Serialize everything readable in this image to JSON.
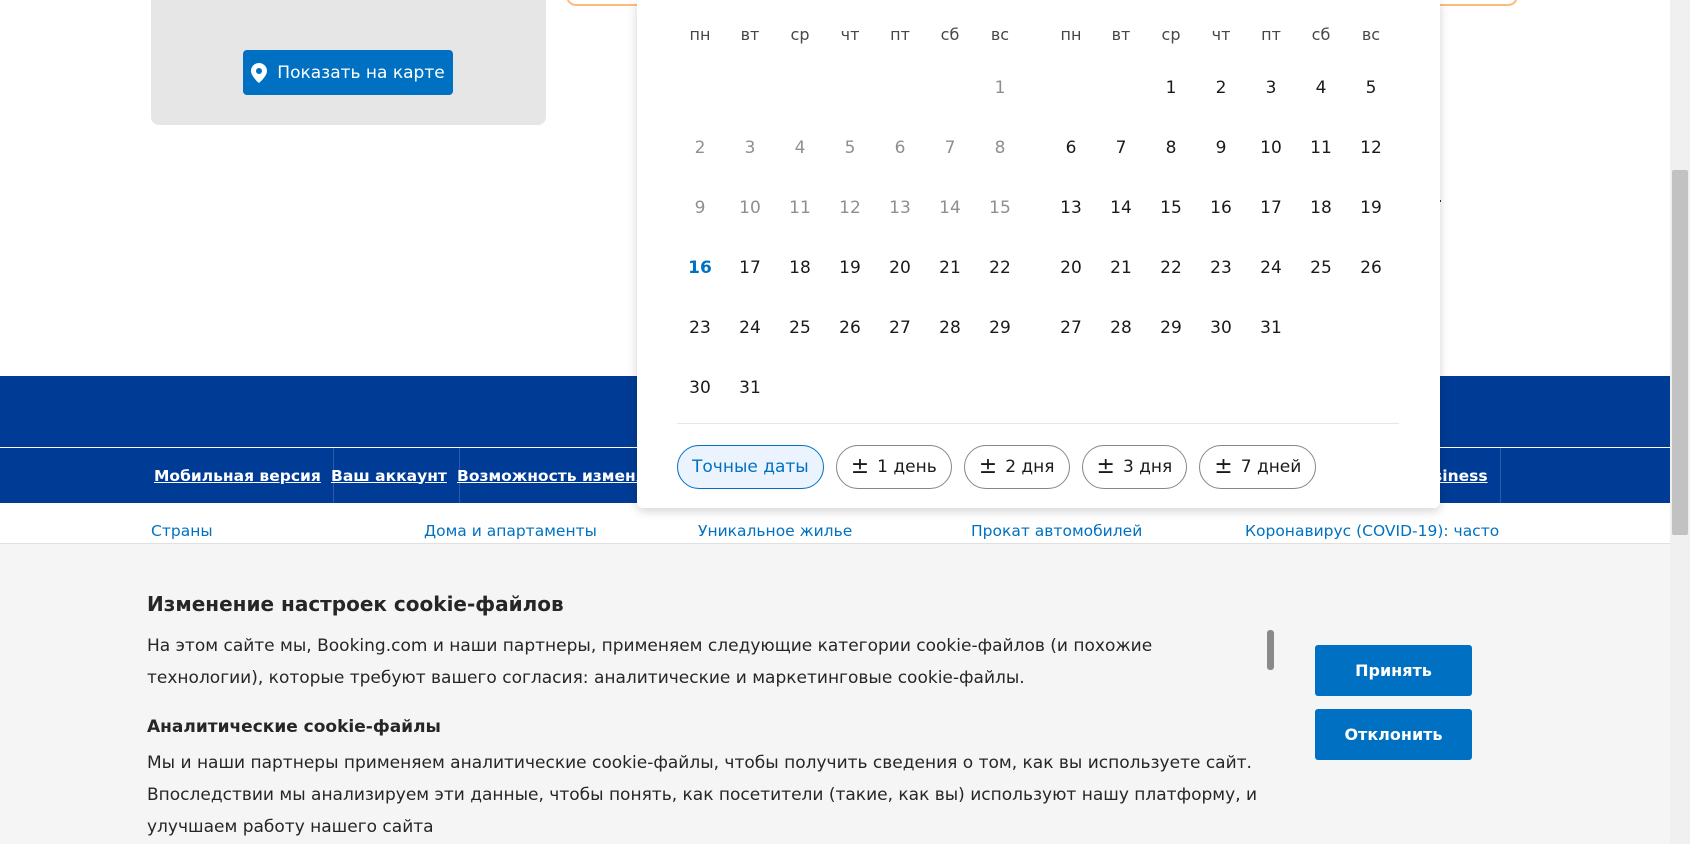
{
  "map": {
    "show_on_map_label": "Показать на карте"
  },
  "calendar": {
    "weekdays": [
      "пн",
      "вт",
      "ср",
      "чт",
      "пт",
      "сб",
      "вс"
    ],
    "month_a": {
      "offset": 6,
      "days": 31,
      "past_until": 15,
      "today": 16
    },
    "month_b": {
      "offset": 2,
      "days": 31,
      "past_until": 0,
      "today": 0
    },
    "flex_options": [
      {
        "label": "Точные даты",
        "active": true,
        "prefix": ""
      },
      {
        "label": "1 день",
        "active": false,
        "prefix": "±"
      },
      {
        "label": "2 дня",
        "active": false,
        "prefix": "±"
      },
      {
        "label": "3 дня",
        "active": false,
        "prefix": "±"
      },
      {
        "label": "7 дней",
        "active": false,
        "prefix": "±"
      }
    ]
  },
  "footer_nav": [
    "Мобильная версия",
    "Ваш аккаунт",
    "Возможность изменят",
    "usiness"
  ],
  "footer_links": [
    "Страны",
    "Дома и апартаменты",
    "Уникальное жилье",
    "Прокат автомобилей",
    "Коронавирус (COVID-19): часто"
  ],
  "cookie": {
    "title": "Изменение настроек cookie-файлов",
    "intro": "На этом сайте мы, Booking.com и наши партнеры, применяем следующие категории cookie-файлов (и похожие технологии), которые требуют вашего согласия: аналитические и маркетинговые cookie-файлы.",
    "analytics_title": "Аналитические cookie-файлы",
    "analytics_text": "Мы и наши партнеры применяем аналитические cookie-файлы, чтобы получить сведения о том, как вы используете сайт. Впоследствии мы анализируем эти данные, чтобы понять, как посетители (такие, как вы) используют нашу платформу, и улучшаем работу нашего сайта",
    "accept_label": "Принять",
    "reject_label": "Отклонить"
  },
  "colors": {
    "brand_blue": "#0071c2",
    "dark_blue": "#003b95",
    "today": "#0071c2",
    "past_day": "#8f8f8f"
  }
}
